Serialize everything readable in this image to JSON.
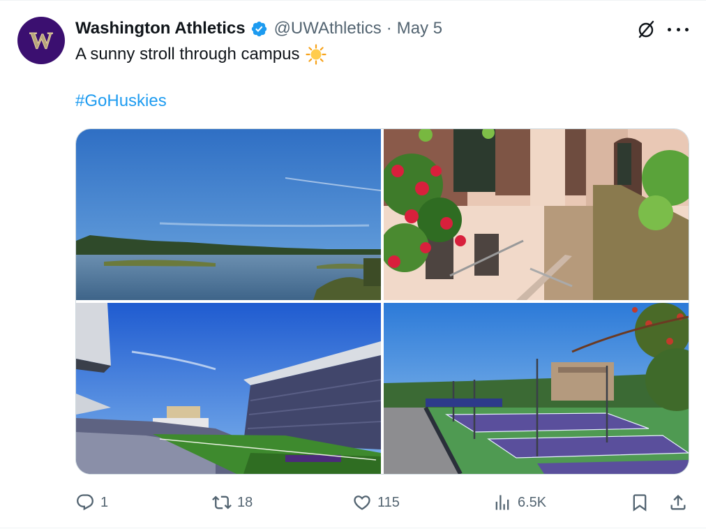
{
  "tweet": {
    "author_name": "Washington Athletics",
    "handle": "@UWAthletics",
    "separator": "·",
    "date": "May 5",
    "text": "A sunny stroll through campus",
    "hashtag": "#GoHuskies",
    "avatar_letter": "W"
  },
  "media": {
    "photos": [
      {
        "subject": "lake-shoreline"
      },
      {
        "subject": "building-flowers"
      },
      {
        "subject": "stadium"
      },
      {
        "subject": "tennis-courts"
      }
    ]
  },
  "actions": {
    "replies": "1",
    "reposts": "18",
    "likes": "115",
    "views": "6.5K"
  },
  "icons": {
    "verified": "verified-badge-icon",
    "grok": "grok-icon",
    "more": "more-icon",
    "reply": "reply-icon",
    "repost": "repost-icon",
    "like": "heart-icon",
    "views": "views-icon",
    "bookmark": "bookmark-icon",
    "share": "share-icon",
    "emoji": "sun-emoji-icon"
  },
  "colors": {
    "accent": "#1d9bf0",
    "text": "#0f1419",
    "secondary": "#536471",
    "avatar_bg": "#3b0f70"
  }
}
